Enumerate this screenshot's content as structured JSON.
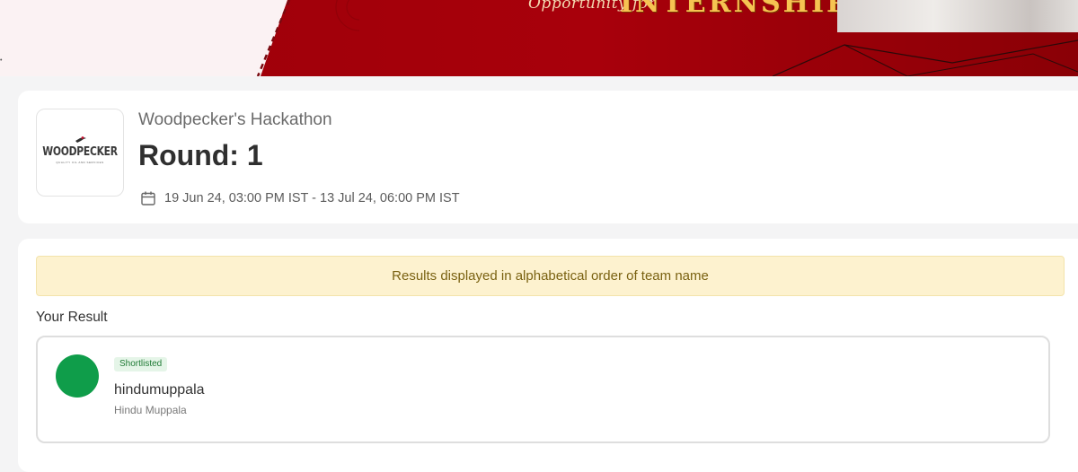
{
  "banner": {
    "tagline": "Opportunity for",
    "headline": "INTERNSHIP",
    "brand_color": "#a8000b"
  },
  "hackathon": {
    "logo_text": "WOODPECKER",
    "logo_subtext": "QUALITY OIL AND SERVICES",
    "name": "Woodpecker's Hackathon",
    "round_title": "Round: 1",
    "date_range": "19 Jun 24, 03:00 PM IST - 13 Jul 24, 06:00 PM IST",
    "date_icon": "calendar-icon"
  },
  "results": {
    "notice": "Results displayed in alphabetical order of team name",
    "section_title": "Your Result",
    "entry": {
      "status": "Shortlisted",
      "status_color": "#1f7a35",
      "avatar_color": "#0f9d4a",
      "team_name": "hindumuppala",
      "member_name": "Hindu Muppala"
    }
  }
}
